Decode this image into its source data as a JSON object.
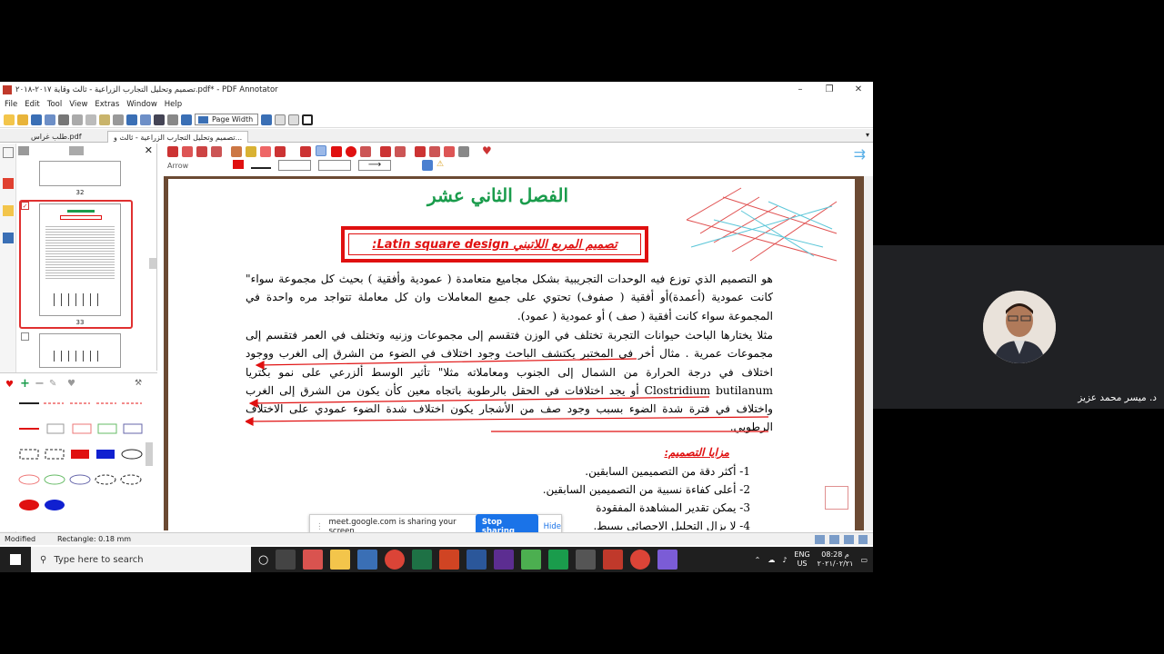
{
  "window": {
    "title": "تصميم وتحليل التجارب الزراعية - ثالث وقاية ٢٠١٧-٢٠١٨.pdf* - PDF Annotator",
    "minimize": "–",
    "maximize": "❐",
    "close": "✕"
  },
  "menu": [
    "File",
    "Edit",
    "Tool",
    "View",
    "Extras",
    "Window",
    "Help"
  ],
  "toolbar": {
    "zoom_value": "Page Width"
  },
  "tabs": [
    {
      "label": "طلب غراس.pdf"
    },
    {
      "label": "تصميم وتحليل التجارب الزراعية - ثالث و..."
    }
  ],
  "thumbnails": [
    {
      "page": "32"
    },
    {
      "page": "33"
    }
  ],
  "annotation_toolbar": {
    "tool_name": "Arrow"
  },
  "document": {
    "chapter_title": "الفصل الثاني عشر",
    "boxed_title": "تصميم المربع اللاتيني Latin square design:",
    "paragraph1": "هو التصميم الذي توزع فيه الوحدات التجريبية بشكل مجاميع متعامدة ( عمودية وأفقية ) بحيث كل مجموعة سواء\" كانت عمودية (أعمدة)أو أفقية ( صفوف) تحتوي على جميع المعاملات وان كل معاملة تتواجد مره واحدة في المجموعة سواء كانت أفقية ( صف ) أو عمودية ( عمود).",
    "paragraph2": "مثلا يختارها الباحث حيوانات التجربة تختلف في الوزن فتقسم إلى مجموعات وزنيه وتختلف في العمر فتقسم إلى مجموعات عمرية . مثال أخر في المختبر يكتشف الباحث وجود اختلاف في الضوء من الشرق إلى الغرب ووجود اختلاف في درجة الحرارة من الشمال إلى الجنوب ومعاملاته مثلا\" تأثير الوسط ألزرعي على نمو بكتريا Clostridium butilanum أو يجد اختلافات في الحقل بالرطوبة باتجاه معين كأن يكون من الشرق إلى الغرب واختلاف في فترة شدة الضوء بسبب وجود صف من الأشجار يكون اختلاف شدة الضوء عمودي على الاختلاف الرطوبي.",
    "advantages_heading": "مزايا التصميم:",
    "advantages": [
      "1- أكثر دقة من التصميمين السابقين.",
      "2- أعلى كفاءة نسبية من التصميمين السابقين.",
      "3- يمكن تقدير المشاهدة المفقودة",
      "4- لا يزال التحليل الإحصائي بسيط."
    ]
  },
  "status": {
    "left": "Modified",
    "tool": "Rectangle: 0.18 mm"
  },
  "screen_share": {
    "message": "meet.google.com is sharing your screen.",
    "stop": "Stop sharing",
    "hide": "Hide"
  },
  "taskbar": {
    "search_placeholder": "Type here to search",
    "lang1": "ENG",
    "lang2": "US",
    "time": "08:28 م",
    "date": "٢٠٢١/٠٢/٢١"
  },
  "meet": {
    "participant_name": "د. ميسر محمد عزيز"
  },
  "colors": {
    "accent_red": "#e01010",
    "title_green": "#1a9c4c",
    "share_blue": "#1a73e8"
  }
}
